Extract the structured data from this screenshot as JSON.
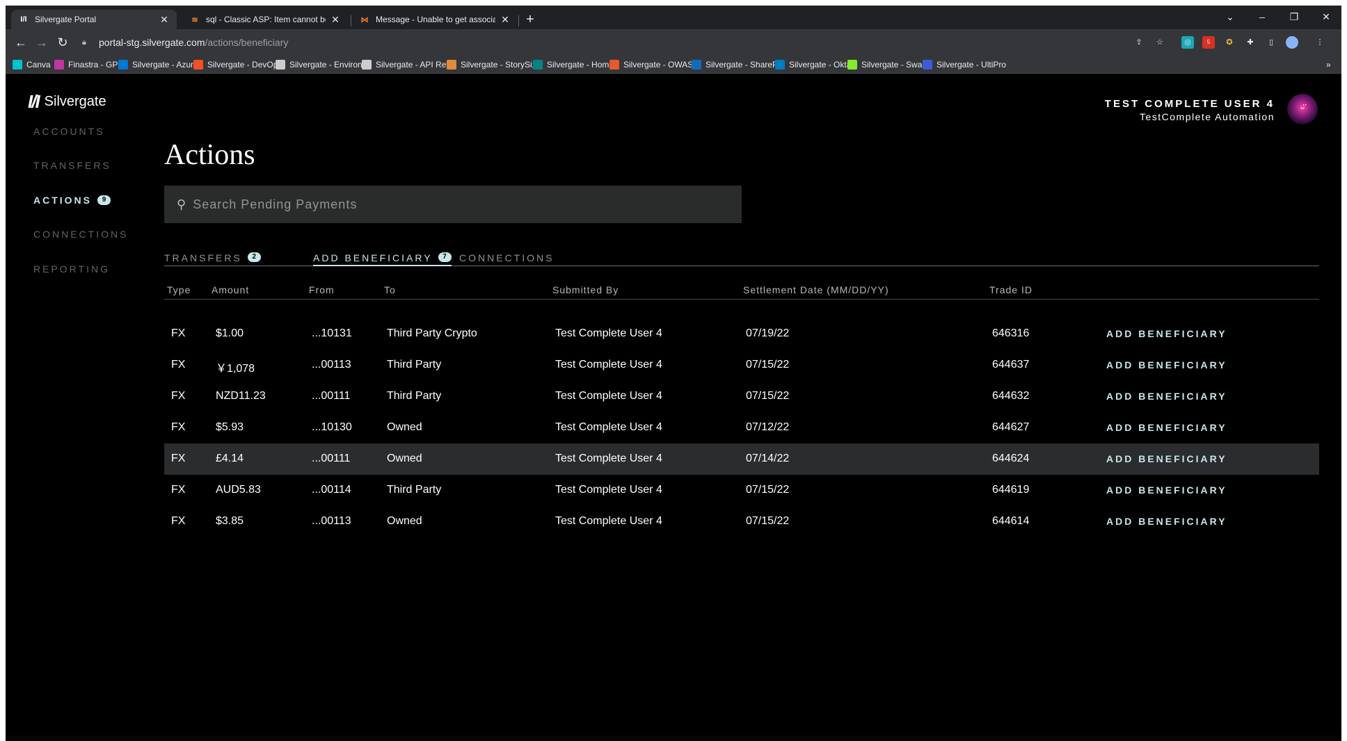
{
  "browser": {
    "tabs": [
      {
        "title": "Silvergate Portal",
        "icon": "silvergate-favicon",
        "active": true
      },
      {
        "title": "sql - Classic ASP: Item cannot be",
        "icon": "stackoverflow-favicon",
        "active": false
      },
      {
        "title": "Message - Unable to get associat",
        "icon": "message-favicon",
        "active": false
      }
    ],
    "url_host": "portal-stg.silvergate.com",
    "url_path": "/actions/beneficiary",
    "bookmarks": [
      {
        "label": "Canva",
        "color": "#00c4cc"
      },
      {
        "label": "Finastra - GPP",
        "color": "#c137a2"
      },
      {
        "label": "Silvergate - Azure",
        "color": "#0078d4"
      },
      {
        "label": "Silvergate - DevOps",
        "color": "#f25022"
      },
      {
        "label": "Silvergate - Environ...",
        "color": "#cccccc"
      },
      {
        "label": "Silvergate - API Ref...",
        "color": "#cccccc"
      },
      {
        "label": "Silvergate - StorySiz...",
        "color": "#e08a3c"
      },
      {
        "label": "Silvergate - Home",
        "color": "#038387"
      },
      {
        "label": "Silvergate - OWASP",
        "color": "#e8582a"
      },
      {
        "label": "Silvergate - ShareP...",
        "color": "#0f6cbd"
      },
      {
        "label": "Silvergate - Okta",
        "color": "#007dc1"
      },
      {
        "label": "Silvergate - Swag",
        "color": "#85ea2d"
      },
      {
        "label": "Silvergate - UltiPro",
        "color": "#3b5bdb"
      }
    ],
    "extension_badge": "5"
  },
  "app": {
    "brand": "Silvergate",
    "user_name": "TEST COMPLETE USER 4",
    "user_org": "TestComplete Automation",
    "sidebar": [
      {
        "label": "ACCOUNTS",
        "badge": null,
        "active": false
      },
      {
        "label": "TRANSFERS",
        "badge": null,
        "active": false
      },
      {
        "label": "ACTIONS",
        "badge": "9",
        "active": true
      },
      {
        "label": "CONNECTIONS",
        "badge": null,
        "active": false
      },
      {
        "label": "REPORTING",
        "badge": null,
        "active": false
      }
    ],
    "title": "Actions",
    "search_placeholder": "Search Pending Payments",
    "tabs": [
      {
        "label": "TRANSFERS",
        "badge": "2",
        "active": false
      },
      {
        "label": "ADD BENEFICIARY",
        "badge": "7",
        "active": true
      },
      {
        "label": "CONNECTIONS",
        "badge": null,
        "active": false
      }
    ],
    "columns": [
      "Type",
      "Amount",
      "From",
      "To",
      "Submitted By",
      "Settlement Date (MM/DD/YY)",
      "Trade ID"
    ],
    "rows": [
      {
        "type": "FX",
        "amount": "$1.00",
        "from": "...10131",
        "to": "Third Party Crypto",
        "submitted_by": "Test Complete User 4",
        "date": "07/19/22",
        "trade_id": "646316",
        "action": "ADD BENEFICIARY"
      },
      {
        "type": "FX",
        "amount": "￥1,078",
        "from": "...00113",
        "to": "Third Party",
        "submitted_by": "Test Complete User 4",
        "date": "07/15/22",
        "trade_id": "644637",
        "action": "ADD BENEFICIARY"
      },
      {
        "type": "FX",
        "amount": "NZD11.23",
        "from": "...00111",
        "to": "Third Party",
        "submitted_by": "Test Complete User 4",
        "date": "07/15/22",
        "trade_id": "644632",
        "action": "ADD BENEFICIARY"
      },
      {
        "type": "FX",
        "amount": "$5.93",
        "from": "...10130",
        "to": "Owned",
        "submitted_by": "Test Complete User 4",
        "date": "07/12/22",
        "trade_id": "644627",
        "action": "ADD BENEFICIARY"
      },
      {
        "type": "FX",
        "amount": "£4.14",
        "from": "...00111",
        "to": "Owned",
        "submitted_by": "Test Complete User 4",
        "date": "07/14/22",
        "trade_id": "644624",
        "action": "ADD BENEFICIARY",
        "highlighted": true
      },
      {
        "type": "FX",
        "amount": "AUD5.83",
        "from": "...00114",
        "to": "Third Party",
        "submitted_by": "Test Complete User 4",
        "date": "07/15/22",
        "trade_id": "644619",
        "action": "ADD BENEFICIARY"
      },
      {
        "type": "FX",
        "amount": "$3.85",
        "from": "...00113",
        "to": "Owned",
        "submitted_by": "Test Complete User 4",
        "date": "07/15/22",
        "trade_id": "644614",
        "action": "ADD BENEFICIARY"
      }
    ],
    "accent_color": "#c8e7ea"
  }
}
